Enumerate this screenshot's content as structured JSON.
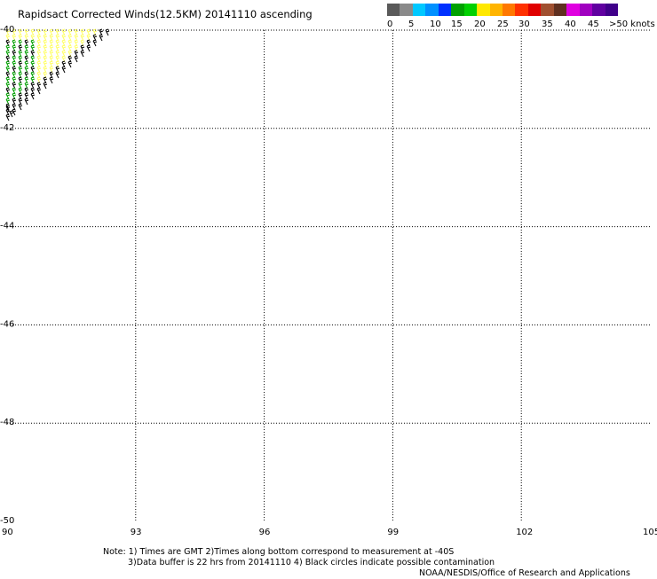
{
  "title": "Rapidsact Corrected Winds(12.5KM) 20141110 ascending",
  "colorbar": {
    "swatches": [
      "#5a5a5a",
      "#8a8a8a",
      "#00c8ff",
      "#0090ff",
      "#0030ff",
      "#00a000",
      "#00d000",
      "#ffe800",
      "#ffb400",
      "#ff7800",
      "#ff3000",
      "#e00000",
      "#a05030",
      "#603020",
      "#e000e0",
      "#a000c0",
      "#6000a0",
      "#40008a"
    ],
    "labels": [
      "0",
      "5",
      "10",
      "15",
      "20",
      "25",
      "30",
      "35",
      "40",
      "45",
      ">50 knots"
    ]
  },
  "map": {
    "lon_ticks": [
      "90",
      "93",
      "96",
      "99",
      "102",
      "105"
    ],
    "lat_ticks": [
      "-40",
      "-42",
      "-44",
      "-46",
      "-48",
      "-50"
    ],
    "lon_range": [
      90,
      105
    ],
    "lat_range": [
      -50,
      -40
    ],
    "grid": "dotted"
  },
  "wind_field": {
    "region": "swath corner near 90E-92.5E, 40S-42S",
    "colors_present": [
      "#00a000",
      "#ffff66",
      "#000000"
    ]
  },
  "notes": {
    "line1": "Note: 1) Times are GMT 2)Times along bottom correspond to measurement at -40S",
    "line2": "3)Data buffer is 22 hrs from 20141110 4) Black circles indicate possible contamination",
    "line3": "NOAA/NESDIS/Office of Research and Applications"
  }
}
